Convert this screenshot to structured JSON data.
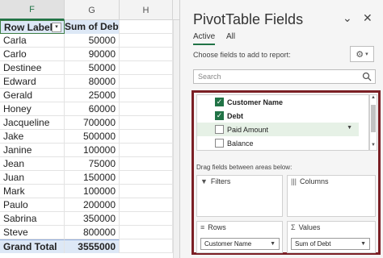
{
  "sheet": {
    "columns": [
      "F",
      "G",
      "H"
    ],
    "header": {
      "labels": "Row Labels",
      "values": "Sum of Debt"
    },
    "rows": [
      {
        "name": "Carla",
        "debt": "50000"
      },
      {
        "name": "Carlo",
        "debt": "90000"
      },
      {
        "name": "Destinee",
        "debt": "50000"
      },
      {
        "name": "Edward",
        "debt": "80000"
      },
      {
        "name": "Gerald",
        "debt": "25000"
      },
      {
        "name": "Honey",
        "debt": "60000"
      },
      {
        "name": "Jacqueline",
        "debt": "700000"
      },
      {
        "name": "Jake",
        "debt": "500000"
      },
      {
        "name": "Janine",
        "debt": "100000"
      },
      {
        "name": "Jean",
        "debt": "75000"
      },
      {
        "name": "Juan",
        "debt": "150000"
      },
      {
        "name": "Mark",
        "debt": "100000"
      },
      {
        "name": "Paulo",
        "debt": "200000"
      },
      {
        "name": "Sabrina",
        "debt": "350000"
      },
      {
        "name": "Steve",
        "debt": "800000"
      }
    ],
    "total": {
      "label": "Grand Total",
      "value": "3555000"
    }
  },
  "pane": {
    "title": "PivotTable Fields",
    "tabs": [
      {
        "label": "Active",
        "active": true
      },
      {
        "label": "All",
        "active": false
      }
    ],
    "choose_label": "Choose fields to add to report:",
    "search_placeholder": "Search",
    "fields": [
      {
        "label": "Customer Name",
        "checked": true,
        "bold": true
      },
      {
        "label": "Debt",
        "checked": true,
        "bold": true
      },
      {
        "label": "Paid Amount",
        "checked": false,
        "bold": false
      },
      {
        "label": "Balance",
        "checked": false,
        "bold": false
      }
    ],
    "drag_label": "Drag fields between areas below:",
    "areas": {
      "filters": {
        "title": "Filters",
        "icon": "filter-icon"
      },
      "columns": {
        "title": "Columns",
        "icon": "columns-icon"
      },
      "rows": {
        "title": "Rows",
        "icon": "rows-icon",
        "value": "Customer Name"
      },
      "values": {
        "title": "Values",
        "icon": "sigma-icon",
        "value": "Sum of Debt"
      }
    }
  },
  "colors": {
    "accent": "#217346",
    "highlight": "#7b1f25",
    "pivot_fill": "#dde8f6"
  }
}
